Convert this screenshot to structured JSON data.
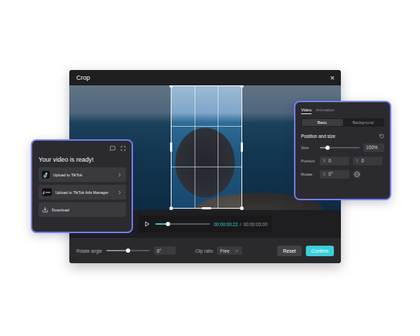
{
  "window": {
    "title": "Crop",
    "close": "×"
  },
  "player": {
    "current": "00:00:00:22",
    "separator": "/",
    "total": "00:00:03:00",
    "level": 0.23
  },
  "controls": {
    "rotate_label": "Rotate angle",
    "rotate_level": 0.5,
    "rotate_value": "0°",
    "clip_label": "Clip ratio",
    "clip_value": "Free",
    "buttons": [
      {
        "label": "Reset",
        "primary": false
      },
      {
        "label": "Confirm",
        "primary": true
      }
    ]
  },
  "export_panel": {
    "title": "Your video is ready!",
    "items": [
      {
        "label": "Upload to TikTok",
        "kind": "tiktok"
      },
      {
        "label": "Upload to TikTok Ads Manager",
        "kind": "ads"
      },
      {
        "label": "Download",
        "kind": "download"
      }
    ]
  },
  "properties_panel": {
    "tabs": [
      {
        "label": "Video",
        "selected": true
      },
      {
        "label": "Animation",
        "selected": false
      }
    ],
    "segments": [
      {
        "label": "Basic",
        "selected": true
      },
      {
        "label": "Background",
        "selected": false
      }
    ],
    "section": "Position and size",
    "rows": [
      {
        "label": "Size",
        "kind": "slider",
        "level": 0.2,
        "value": "100%"
      },
      {
        "label": "Position",
        "kind": "fields",
        "fields": [
          {
            "prefix": "X",
            "value": "0"
          },
          {
            "prefix": "Y",
            "value": "0"
          }
        ]
      },
      {
        "label": "Rotate",
        "kind": "angle",
        "fields": [
          {
            "prefix": "X",
            "value": "0°"
          }
        ]
      }
    ]
  }
}
